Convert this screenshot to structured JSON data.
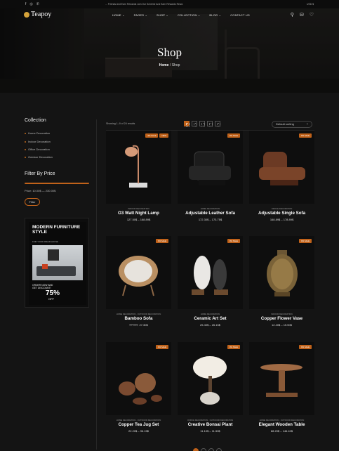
{
  "topbar": {
    "ticker": "... Friends And Earn Rewards    Join Our Scheme And Earn Rewards    Rewa",
    "currency": "USD $"
  },
  "header": {
    "logo": "Teapoy",
    "nav": [
      "HOME ⌄",
      "PAGES ⌄",
      "SHOP ⌄",
      "COLLECTION ⌄",
      "BLOG ⌄",
      "CONTACT US"
    ]
  },
  "hero": {
    "title": "Shop",
    "breadcrumb_home": "Home",
    "breadcrumb_sep": "/",
    "breadcrumb_current": "Shop"
  },
  "sidebar": {
    "collection_title": "Collection",
    "categories": [
      "Home Decoration",
      "Indoor Decoration",
      "Office Decoration",
      "Outdoor Decoration"
    ],
    "filter_title": "Filter By Price",
    "price_text": "Price: 10.00$ — 230.00$",
    "filter_button": "Filter",
    "promo": {
      "headline": "MODERN FURNITURE STYLE",
      "sub": "FIND YOUR DREAM HOUSE",
      "cta": "ORDER NOW AND GET DISCOUNT!",
      "discount": "75%",
      "off": "OFF"
    }
  },
  "shop": {
    "results": "Showing 1–9 of 24 results",
    "sorting": "Default sorting",
    "products": [
      {
        "badges": [
          "9% SALE",
          "NEW"
        ],
        "category": "INDOOR DECORATION",
        "name": "O3 Watt Night Lamp",
        "old_price": "",
        "price": "127.50$ – 168.89$"
      },
      {
        "badges": [
          "9% SALE"
        ],
        "category": "HOME DECORATION",
        "name": "Adjustable Leather Sofa",
        "old_price": "",
        "price": "172.30$ – 173.75$"
      },
      {
        "badges": [
          "9% SALE"
        ],
        "category": "OFFICE DECORATION",
        "name": "Adjustable Single Sofa",
        "old_price": "",
        "price": "168.89$ – 178.89$"
      },
      {
        "badges": [
          "9% SALE"
        ],
        "category": "HOME DECORATION , OUTDOOR DECORATION",
        "name": "Bamboo Sofa",
        "old_price": "37.00$",
        "price": "27.30$"
      },
      {
        "badges": [
          "9% SALE"
        ],
        "category": "HOME DECORATION",
        "name": "Ceramic Art Set",
        "old_price": "",
        "price": "25.40$ – 26.15$"
      },
      {
        "badges": [
          "9% SALE"
        ],
        "category": "INDOOR DECORATION",
        "name": "Copper Flower Vase",
        "old_price": "",
        "price": "12.40$ – 15.50$"
      },
      {
        "badges": [
          "9% SALE"
        ],
        "category": "HOME DECORATION , OUTDOOR DECORATION",
        "name": "Copper Tea Jug Set",
        "old_price": "",
        "price": "22.20$ – 96.15$"
      },
      {
        "badges": [
          "9% SALE"
        ],
        "category": "OFFICE DECORATION , OUTDOOR DECORATION",
        "name": "Creative Bonsai Plant",
        "old_price": "",
        "price": "11.10$ – 11.50$"
      },
      {
        "badges": [
          "9% SALE"
        ],
        "category": "HOME DECORATION , OUTDOOR DECORATION",
        "name": "Elegant Wooden Table",
        "old_price": "",
        "price": "88.20$ – 146.40$"
      }
    ]
  },
  "colors": {
    "accent": "#c0621a",
    "background": "#141414"
  }
}
